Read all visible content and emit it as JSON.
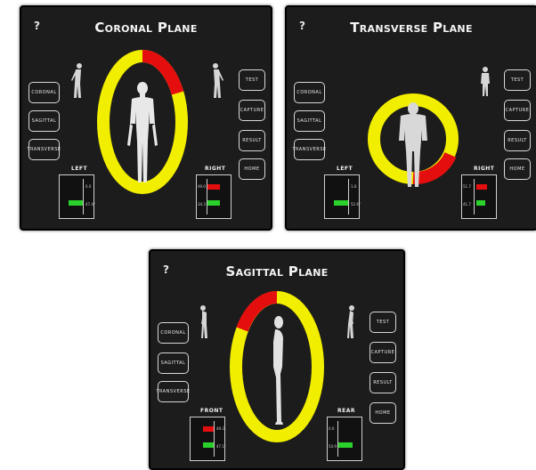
{
  "help_symbol": "?",
  "buttons_left": [
    "Coronal",
    "Sagittal",
    "Transverse"
  ],
  "buttons_right": [
    "Test",
    "Capture",
    "Result",
    "Home"
  ],
  "colors": {
    "ring": "#f2ee00",
    "highlight": "#e50e0e",
    "good": "#2bd12b",
    "background": "#1c1c1c"
  },
  "panels": [
    {
      "title": "Coronal Plane",
      "left_label": "Left",
      "right_label": "Right",
      "left_values": [
        "0.0",
        "47.4°"
      ],
      "right_values": [
        "49.0",
        "34.3"
      ]
    },
    {
      "title": "Transverse Plane",
      "left_label": "Left",
      "right_label": "Right",
      "left_values": [
        "1.6",
        "52.6°"
      ],
      "right_values": [
        "51.7",
        "41.7"
      ]
    },
    {
      "title": "Sagittal Plane",
      "left_label": "Front",
      "right_label": "Rear",
      "left_values": [
        "49.3",
        "47.1°"
      ],
      "right_values": [
        "0.0",
        "54.9"
      ]
    }
  ]
}
